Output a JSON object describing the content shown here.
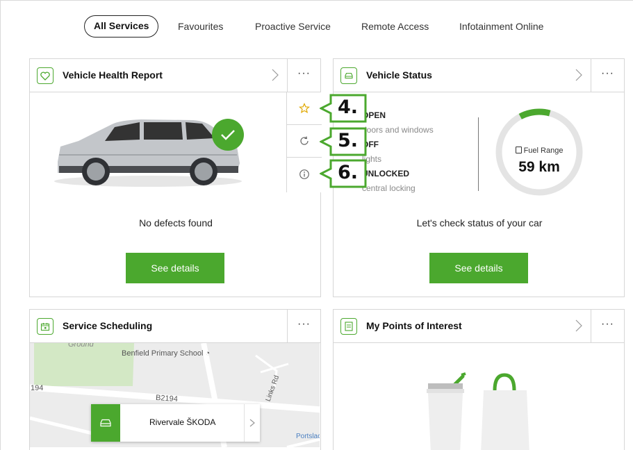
{
  "nav": {
    "tabs": [
      {
        "label": "All Services",
        "active": true
      },
      {
        "label": "Favourites"
      },
      {
        "label": "Proactive Service"
      },
      {
        "label": "Remote Access"
      },
      {
        "label": "Infotainment Online"
      }
    ]
  },
  "colors": {
    "accent": "#4ba82e",
    "border": "#d6d6d6",
    "map_bg": "#ececec"
  },
  "health": {
    "title": "Vehicle Health Report",
    "status": "No defects found",
    "button": "See details",
    "icon": "heart-icon"
  },
  "side_menu": {
    "items": [
      {
        "icon": "star-icon",
        "callout": "4."
      },
      {
        "icon": "refresh-icon",
        "callout": "5."
      },
      {
        "icon": "info-icon",
        "callout": "6."
      }
    ]
  },
  "vehicle_status": {
    "title": "Vehicle Status",
    "rows": [
      {
        "value": "OPEN",
        "label": "doors and windows"
      },
      {
        "value": "OFF",
        "label": "lights"
      },
      {
        "value": "UNLOCKED",
        "label": "central locking"
      }
    ],
    "fuel_label": "Fuel Range",
    "fuel_value": "59 km",
    "fuel_level": 0.12,
    "message": "Let's check status of your car",
    "button": "See details"
  },
  "scheduling": {
    "title": "Service Scheduling",
    "map_labels": {
      "ground": "Ground",
      "school": "Benfield Primary School",
      "road_num": "194",
      "road_b": "B2194",
      "links_rd": "Links Rd",
      "portslade": "Portslac"
    },
    "dealer": "Rivervale ŠKODA"
  },
  "poi": {
    "title": "My Points of Interest"
  }
}
